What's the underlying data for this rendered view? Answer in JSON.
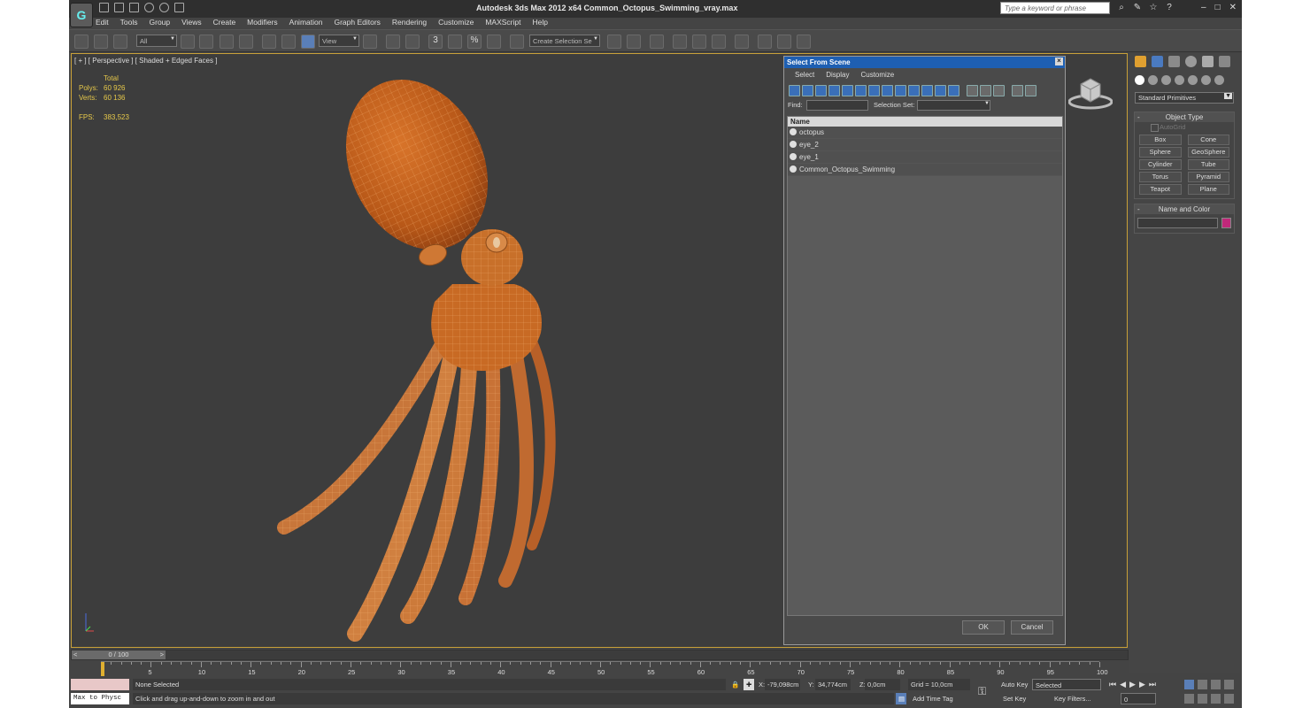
{
  "app": {
    "title": "Autodesk 3ds Max  2012 x64     Common_Octopus_Swimming_vray.max",
    "search_placeholder": "Type a keyword or phrase",
    "logo_text": "G"
  },
  "menu": [
    "Edit",
    "Tools",
    "Group",
    "Views",
    "Create",
    "Modifiers",
    "Animation",
    "Graph Editors",
    "Rendering",
    "Customize",
    "MAXScript",
    "Help"
  ],
  "toolbar": {
    "filter_value": "All",
    "refcoord_value": "View",
    "named_selection_placeholder": "Create Selection Se",
    "snap_3": "3",
    "snap_angle": "",
    "percent": "%"
  },
  "viewport": {
    "label": "[ + ] [ Perspective ] [ Shaded + Edged Faces ]",
    "stats": {
      "total_label": "Total",
      "polys_label": "Polys:",
      "polys_value": "60 926",
      "verts_label": "Verts:",
      "verts_value": "60 136",
      "fps_label": "FPS:",
      "fps_value": "383,523"
    },
    "axis_labels": {
      "z": "z",
      "x": "x",
      "y": "y"
    }
  },
  "command_panel": {
    "category_value": "Standard Primitives",
    "object_type_title": "Object Type",
    "autogrid_label": "AutoGrid",
    "objects": [
      "Box",
      "Cone",
      "Sphere",
      "GeoSphere",
      "Cylinder",
      "Tube",
      "Torus",
      "Pyramid",
      "Teapot",
      "Plane"
    ],
    "name_color_title": "Name and Color",
    "swatch_color": "#c0287a"
  },
  "dialog": {
    "title": "Select From Scene",
    "menu": [
      "Select",
      "Display",
      "Customize"
    ],
    "find_label": "Find:",
    "selection_set_label": "Selection Set:",
    "column_header": "Name",
    "items": [
      "octopus",
      "eye_2",
      "eye_1",
      "Common_Octopus_Swimming"
    ],
    "ok_label": "OK",
    "cancel_label": "Cancel"
  },
  "timeline": {
    "slider_label": "0 / 100",
    "ticks": [
      "0",
      "5",
      "10",
      "15",
      "20",
      "25",
      "30",
      "35",
      "40",
      "45",
      "50",
      "55",
      "60",
      "65",
      "70",
      "75",
      "80",
      "85",
      "90",
      "95",
      "100"
    ]
  },
  "statusbar": {
    "maxscript_text": "Max to Physc",
    "selection_status": "None Selected",
    "prompt": "Click and drag up-and-down to zoom in and out",
    "x_label": "X:",
    "x_value": "-79,098cm",
    "y_label": "Y:",
    "y_value": "34,774cm",
    "z_label": "Z:",
    "z_value": "0,0cm",
    "grid": "Grid = 10,0cm",
    "add_time_tag": "Add Time Tag",
    "auto_key": "Auto Key",
    "set_key": "Set Key",
    "key_mode_value": "Selected",
    "key_filters": "Key Filters...",
    "frame_value": "0"
  },
  "colors": {
    "octopus_body": "#c4621c",
    "viewport_border": "#c8a038",
    "dialog_title": "#1e5fb2",
    "stats_text": "#e6c84a"
  }
}
